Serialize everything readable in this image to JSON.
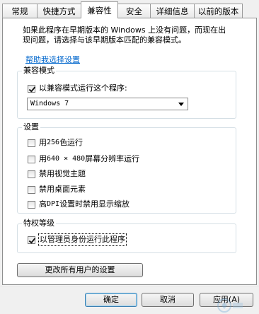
{
  "tabs": [
    {
      "label": "常规",
      "active": false
    },
    {
      "label": "快捷方式",
      "active": false
    },
    {
      "label": "兼容性",
      "active": true
    },
    {
      "label": "安全",
      "active": false
    },
    {
      "label": "详细信息",
      "active": false
    },
    {
      "label": "以前的版本",
      "active": false
    }
  ],
  "intro": {
    "line1": "如果此程序在早期版本的 Windows 上没有问题，而现在出",
    "line2": "现问题，请选择与该早期版本匹配的兼容模式。"
  },
  "help_link": "帮助我选择设置",
  "compat_mode": {
    "title": "兼容模式",
    "checkbox_label": "以兼容模式运行这个程序:",
    "checked": true,
    "selected_os": "Windows 7"
  },
  "settings": {
    "title": "设置",
    "options": [
      {
        "prefix": "用 ",
        "mono": "256",
        "suffix": " 色运行",
        "checked": false
      },
      {
        "prefix": "用 ",
        "mono": "640 × 480",
        "suffix": " 屏幕分辨率运行",
        "checked": false
      },
      {
        "prefix": "",
        "mono": "",
        "suffix": "禁用视觉主题",
        "checked": false
      },
      {
        "prefix": "",
        "mono": "",
        "suffix": "禁用桌面元素",
        "checked": false
      },
      {
        "prefix": "高 ",
        "mono": "DPI",
        "suffix": " 设置时禁用显示缩放",
        "checked": false
      }
    ]
  },
  "privilege": {
    "title": "特权等级",
    "checkbox_label": "以管理员身份运行此程序",
    "checked": true
  },
  "all_users_button": "更改所有用户的设置",
  "buttons": {
    "ok": "确定",
    "cancel": "取消",
    "apply": "应用(A)"
  },
  "colors": {
    "link": "#0066cc",
    "panel_border": "#8e8f8f",
    "group_border": "#d5dfe5"
  }
}
